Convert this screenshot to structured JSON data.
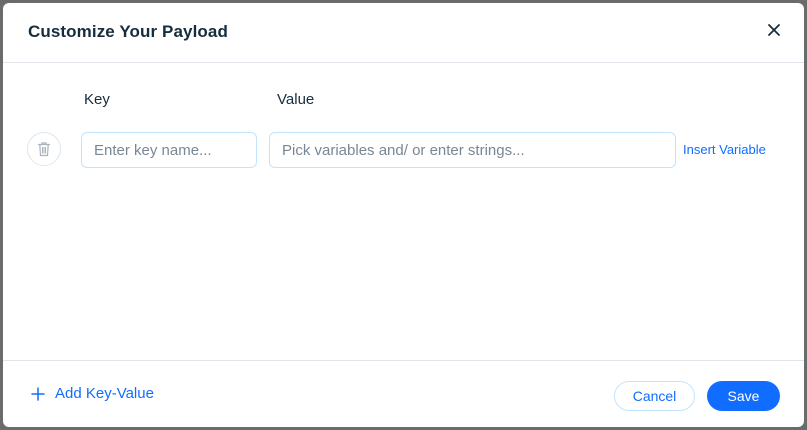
{
  "dialog": {
    "title": "Customize Your Payload"
  },
  "columns": {
    "key_label": "Key",
    "value_label": "Value"
  },
  "row": {
    "key_placeholder": "Enter key name...",
    "key_value": "",
    "value_placeholder": "Pick variables and/ or enter strings...",
    "value_value": "",
    "insert_variable_label": "Insert Variable"
  },
  "footer": {
    "add_key_value_label": "Add Key-Value",
    "cancel_label": "Cancel",
    "save_label": "Save"
  },
  "icons": {
    "close": "close-icon",
    "trash": "trash-icon",
    "plus": "plus-icon"
  },
  "colors": {
    "accent": "#116dff",
    "title_text": "#162d3d",
    "border": "#dfe5eb",
    "input_border": "#c1e4fe"
  }
}
